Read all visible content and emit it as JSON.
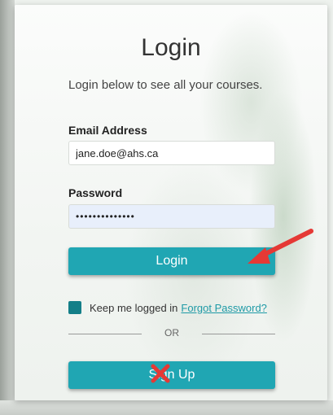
{
  "login_form": {
    "title": "Login",
    "subtitle": "Login below to see all your courses.",
    "email_label": "Email Address",
    "email_value": "jane.doe@ahs.ca",
    "password_label": "Password",
    "password_value": "••••••••••••••",
    "login_button": "Login",
    "remember_label": "Keep me logged in",
    "forgot_link": "Forgot Password?",
    "or_text": "OR",
    "signup_button": "Sign Up"
  },
  "annotations": {
    "arrow_icon": "red-arrow-icon",
    "x_icon": "red-x-icon",
    "annotation_color": "#e53935"
  },
  "colors": {
    "accent": "#20a6b3",
    "checkbox": "#137f88",
    "link": "#1e9aa6"
  }
}
